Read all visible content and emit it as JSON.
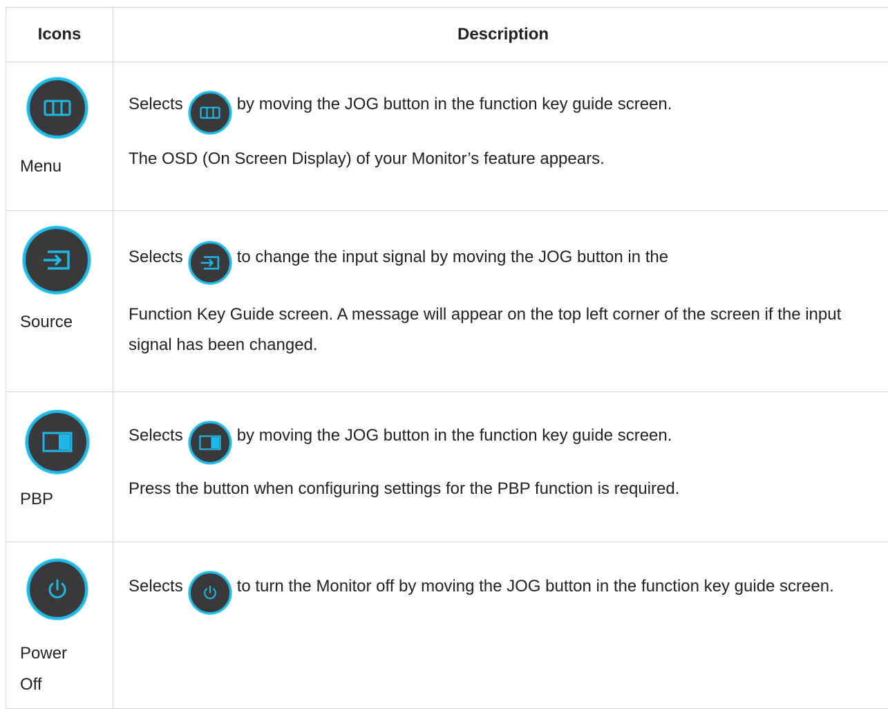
{
  "header": {
    "icons": "Icons",
    "description": "Description"
  },
  "accent_color": "#1fb9e8",
  "icon_bg_color": "#39393b",
  "rows": [
    {
      "label": "Menu",
      "icon": "menu-grid-icon",
      "line1_before": "Selects",
      "line1_after": "by moving the JOG button in the function key guide screen.",
      "line2": "The OSD (On Screen Display) of your Monitor’s feature appears."
    },
    {
      "label": "Source",
      "icon": "source-input-icon",
      "line1_before": "Selects",
      "line1_after": "to change the input signal by moving the JOG button in the",
      "line2": "Function Key Guide screen. A message will appear on the top left corner of the screen if the input signal has been changed."
    },
    {
      "label": "PBP",
      "icon": "pbp-split-icon",
      "line1_before": "Selects",
      "line1_after": "by moving the JOG button in the function key guide screen.",
      "line2": "Press the button when configuring settings for the PBP function is required."
    },
    {
      "label": "Power Off",
      "label_line1": "Power",
      "label_line2": "Off",
      "icon": "power-icon",
      "line1_before": "Selects",
      "line1_after": "to turn the Monitor off by moving the JOG button in the function key guide screen."
    }
  ]
}
